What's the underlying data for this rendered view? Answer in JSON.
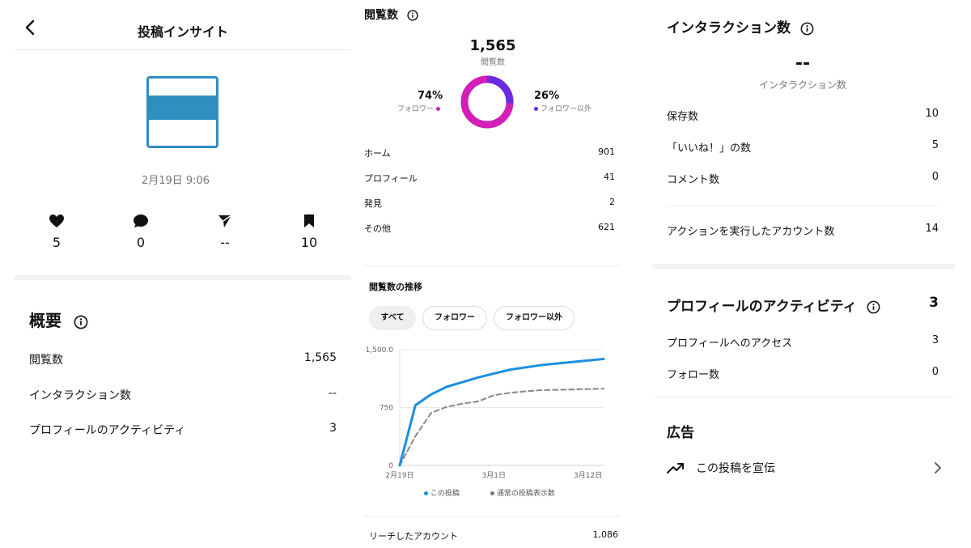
{
  "left": {
    "title": "投稿インサイト",
    "date": "2月19日 9:06",
    "stats": {
      "likes": "5",
      "comments": "0",
      "shares": "--",
      "saves": "10"
    },
    "overview": {
      "title": "概要",
      "rows": [
        {
          "label": "閲覧数",
          "value": "1,565"
        },
        {
          "label": "インタラクション数",
          "value": "--"
        },
        {
          "label": "プロフィールのアクティビティ",
          "value": "3"
        }
      ]
    }
  },
  "middle": {
    "title": "閲覧数",
    "total": "1,565",
    "total_label": "閲覧数",
    "followers_pct": "74%",
    "followers_label": "フォロワー",
    "nonfollowers_pct": "26%",
    "nonfollowers_label": "フォロワー以外",
    "sources": [
      {
        "label": "ホーム",
        "value": "901"
      },
      {
        "label": "プロフィール",
        "value": "41"
      },
      {
        "label": "発見",
        "value": "2"
      },
      {
        "label": "その他",
        "value": "621"
      }
    ],
    "trend_title": "閲覧数の推移",
    "filters": [
      "すべて",
      "フォロワー",
      "フォロワー以外"
    ],
    "reach_label": "リーチしたアカウント",
    "reach_value": "1,086"
  },
  "chart_data": {
    "type": "line",
    "x": [
      "2月19日",
      "2月20日",
      "2月22日",
      "2月24日",
      "2月26日",
      "2月28日",
      "3月1日",
      "3月3日",
      "3月5日",
      "3月7日",
      "3月9日",
      "3月11日",
      "3月12日",
      "3月13日"
    ],
    "xticks": [
      "2月19日",
      "3月1日",
      "3月12日"
    ],
    "yticks": [
      "0",
      "750",
      "1,500.0"
    ],
    "ylim": [
      0,
      1500
    ],
    "series": [
      {
        "name": "この投稿",
        "color": "#1a8fe3",
        "style": "solid",
        "values": [
          0,
          780,
          920,
          1020,
          1080,
          1140,
          1190,
          1240,
          1270,
          1300,
          1320,
          1340,
          1360,
          1380
        ]
      },
      {
        "name": "通常の投稿表示数",
        "color": "#888888",
        "style": "dashed",
        "values": [
          0,
          380,
          680,
          760,
          800,
          830,
          910,
          940,
          960,
          975,
          980,
          985,
          990,
          995
        ]
      }
    ]
  },
  "right": {
    "interactions_title": "インタラクション数",
    "interactions_value": "--",
    "interactions_label": "インタラクション数",
    "interaction_rows": [
      {
        "label": "保存数",
        "value": "10"
      },
      {
        "label": "「いいね！」の数",
        "value": "5"
      },
      {
        "label": "コメント数",
        "value": "0"
      }
    ],
    "accounts_label": "アクションを実行したアカウント数",
    "accounts_value": "14",
    "profile_title": "プロフィールのアクティビティ",
    "profile_value": "3",
    "profile_rows": [
      {
        "label": "プロフィールへのアクセス",
        "value": "3"
      },
      {
        "label": "フォロー数",
        "value": "0"
      }
    ],
    "ads_title": "広告",
    "promote_label": "この投稿を宣伝"
  },
  "colors": {
    "accent": "#2f8fbf",
    "followers": "#d21fb8",
    "nonfollowers": "#6a2be0",
    "line": "#1a8fe3"
  }
}
